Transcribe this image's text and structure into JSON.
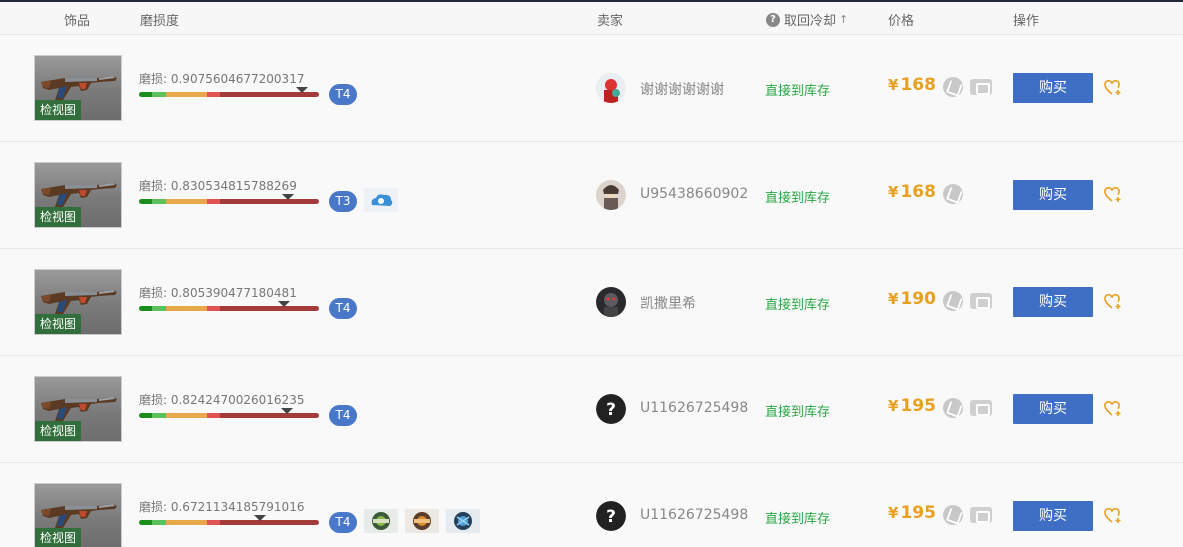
{
  "header": {
    "item": "饰品",
    "wear": "磨损度",
    "seller": "卖家",
    "cooldown": "取回冷却",
    "cooldown_help_icon": "question-circle-icon",
    "cooldown_sort_icon": "arrow-up-icon",
    "price": "价格",
    "action": "操作"
  },
  "colors": {
    "accent_blue": "#3f6fc4",
    "tier_blue": "#4a78c8",
    "price_orange": "#e8a020",
    "delivery_green": "#28a745"
  },
  "listings": [
    {
      "thumb_label": "检视图",
      "wear_label": "磨损: 0.9075604677200317",
      "wear_value": 0.9075604677200317,
      "tier": "T4",
      "stickers": [],
      "avatar": "avatar-red-character",
      "seller": "谢谢谢谢谢谢",
      "delivery": "直接到库存",
      "currency": "¥",
      "price": "168",
      "pay_icons": [
        "alipay-icon",
        "ticket-icon"
      ],
      "buy_label": "购买",
      "fav_icon": "heart-plus-icon"
    },
    {
      "thumb_label": "检视图",
      "wear_label": "磨损: 0.830534815788269",
      "wear_value": 0.830534815788269,
      "tier": "T3",
      "stickers": [
        "sticker-cloud9"
      ],
      "avatar": "avatar-anime-character",
      "seller": "U95438660902",
      "delivery": "直接到库存",
      "currency": "¥",
      "price": "168",
      "pay_icons": [
        "alipay-icon"
      ],
      "buy_label": "购买",
      "fav_icon": "heart-plus-icon"
    },
    {
      "thumb_label": "检视图",
      "wear_label": "磨损: 0.805390477180481",
      "wear_value": 0.805390477180481,
      "tier": "T4",
      "stickers": [],
      "avatar": "avatar-dark-character",
      "seller": "凯撒里希",
      "delivery": "直接到库存",
      "currency": "¥",
      "price": "190",
      "pay_icons": [
        "alipay-icon",
        "ticket-icon"
      ],
      "buy_label": "购买",
      "fav_icon": "heart-plus-icon"
    },
    {
      "thumb_label": "检视图",
      "wear_label": "磨损: 0.8242470026016235",
      "wear_value": 0.8242470026016235,
      "tier": "T4",
      "stickers": [],
      "avatar": "avatar-unknown-question",
      "seller": "U11626725498",
      "delivery": "直接到库存",
      "currency": "¥",
      "price": "195",
      "pay_icons": [
        "alipay-icon",
        "ticket-icon"
      ],
      "buy_label": "购买",
      "fav_icon": "heart-plus-icon"
    },
    {
      "thumb_label": "检视图",
      "wear_label": "磨损: 0.6721134185791016",
      "wear_value": 0.6721134185791016,
      "tier": "T4",
      "stickers": [
        "sticker-green-emblem",
        "sticker-orange-emblem",
        "sticker-blue-emblem"
      ],
      "avatar": "avatar-unknown-question",
      "seller": "U11626725498",
      "delivery": "直接到库存",
      "currency": "¥",
      "price": "195",
      "pay_icons": [
        "alipay-icon",
        "ticket-icon"
      ],
      "buy_label": "购买",
      "fav_icon": "heart-plus-icon"
    }
  ]
}
